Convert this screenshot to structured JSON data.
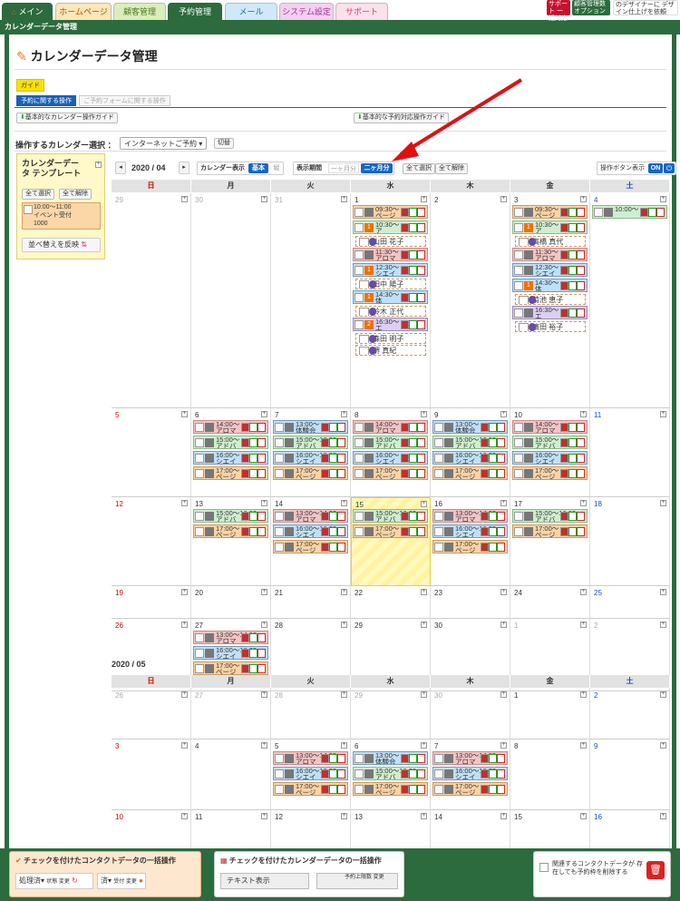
{
  "nav": {
    "tabs": [
      "メイン",
      "ホームページ",
      "顧客管理",
      "予約管理",
      "メール",
      "システム設定",
      "サポート"
    ],
    "promo1": "サポート 一括対応",
    "promo2": "顧客管理数 オプション",
    "promo3": "のデザイナーに デザイン仕上げを依頼"
  },
  "breadcrumb": "カレンダーデータ管理",
  "page_title": "カレンダーデータ管理",
  "guide": "ガイド",
  "subtabs": [
    "予約に関する操作",
    "ご予約フォームに関する操作"
  ],
  "guides": {
    "left": "基本的なカレンダー操作ガイド",
    "right": "基本的な予約対応操作ガイド"
  },
  "calendar_select": {
    "label": "操作するカレンダー選択 ：",
    "value": "インターネットご予約",
    "switch": "切替"
  },
  "template": {
    "title": "カレンダーデータ テンプレート",
    "select_all": "全て選択",
    "clear_all": "全て解除",
    "item_time": "10:00～11:00",
    "item_name": "イベント受付",
    "item_count": "1000",
    "apply": "並べ替えを反映"
  },
  "controls": {
    "month": "2020 / 04",
    "cal_display": "カレンダー表示",
    "basic": "基本",
    "vertical": "縦",
    "period": "表示期間",
    "one_month": "一ヶ月分",
    "two_month": "二ヶ月分",
    "select_all": "全て選択",
    "clear_all": "全て解除",
    "op_buttons": "操作ボタン表示",
    "on": "ON"
  },
  "weekdays": [
    "日",
    "月",
    "火",
    "水",
    "木",
    "金",
    "土"
  ],
  "month2": "2020 / 05",
  "persons": {
    "p1": "山田 花子",
    "p2": "田中 陽子",
    "p3": "鈴木 正代",
    "p4": "森田 明子",
    "p5": "堺 真紀",
    "p6": "高橋 真代",
    "p7": "菊池 恵子",
    "p8": "演田 裕子"
  },
  "events": {
    "e0930": "09:30～",
    "page": "ページ",
    "e1030": "10:30～",
    "a": "ア",
    "e1130": "11:30～",
    "aroma": "アロマ",
    "e1230": "12:30～",
    "shiei": "シエイ",
    "e1430": "14:30～",
    "tai": "体",
    "e1530": "15:30～",
    "ta": "タ",
    "e1630": "16:30～",
    "e": "エ",
    "e1000": "10:00～",
    "e1400": "14:00～",
    "e1300": "13:00～",
    "taiken": "体験会",
    "e1500": "15:00～",
    "e1500b": "15:00～16:00",
    "adoba": "アドバ",
    "e1600": "16:00～",
    "e1600b": "16:00～16:00",
    "e1700": "17:00～",
    "e1300b": "13:00～14:00",
    "n1": "1",
    "n2": "2"
  },
  "bottom": {
    "contact_title": "チェックを付けたコンタクトデータの一括操作",
    "processed": "処理済",
    "status": "状態 変更",
    "done": "済",
    "received": "受付 変更",
    "cal_title": "チェックを付けたカレンダーデータの一括操作",
    "text_display": "テキスト表示",
    "reserve_limit": "予約上限数 変更",
    "delete_note": "関連するコンタクトデータが 存在しても予約枠を削除する"
  }
}
